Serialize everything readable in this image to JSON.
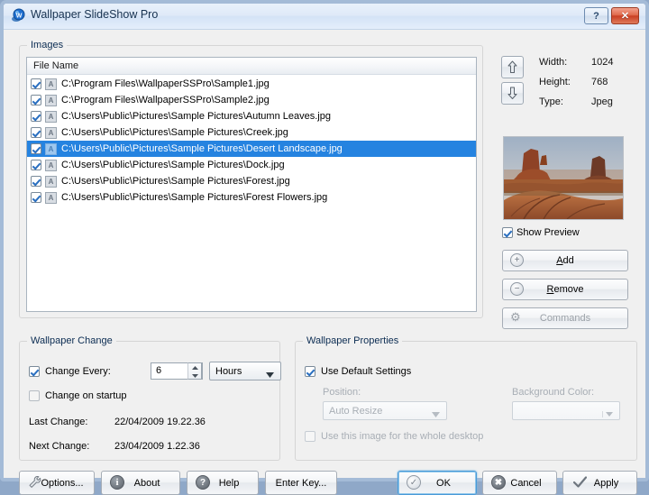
{
  "window": {
    "title": "Wallpaper SlideShow Pro",
    "icon": "app-logo-icon",
    "help_button": "?",
    "close_button": "✕"
  },
  "images_group": {
    "label": "Images",
    "column_header": "File Name",
    "rows": [
      {
        "checked": true,
        "tag": "A",
        "path": "C:\\Program Files\\WallpaperSSPro\\Sample1.jpg",
        "selected": false
      },
      {
        "checked": true,
        "tag": "A",
        "path": "C:\\Program Files\\WallpaperSSPro\\Sample2.jpg",
        "selected": false
      },
      {
        "checked": true,
        "tag": "A",
        "path": "C:\\Users\\Public\\Pictures\\Sample Pictures\\Autumn Leaves.jpg",
        "selected": false
      },
      {
        "checked": true,
        "tag": "A",
        "path": "C:\\Users\\Public\\Pictures\\Sample Pictures\\Creek.jpg",
        "selected": false
      },
      {
        "checked": true,
        "tag": "A",
        "path": "C:\\Users\\Public\\Pictures\\Sample Pictures\\Desert Landscape.jpg",
        "selected": true
      },
      {
        "checked": true,
        "tag": "A",
        "path": "C:\\Users\\Public\\Pictures\\Sample Pictures\\Dock.jpg",
        "selected": false
      },
      {
        "checked": true,
        "tag": "A",
        "path": "C:\\Users\\Public\\Pictures\\Sample Pictures\\Forest.jpg",
        "selected": false
      },
      {
        "checked": true,
        "tag": "A",
        "path": "C:\\Users\\Public\\Pictures\\Sample Pictures\\Forest Flowers.jpg",
        "selected": false
      }
    ]
  },
  "side_panel": {
    "move_up": "⬆",
    "move_down": "⬇",
    "width_label": "Width:",
    "width_value": "1024",
    "height_label": "Height:",
    "height_value": "768",
    "type_label": "Type:",
    "type_value": "Jpeg",
    "preview_alt": "desert-landscape-preview",
    "show_preview_label": "Show Preview",
    "show_preview_checked": true,
    "add_label": "Add",
    "add_accel": "A",
    "remove_label": "Remove",
    "remove_accel": "R",
    "commands_label": "Commands",
    "commands_enabled": false
  },
  "wallpaper_change": {
    "label": "Wallpaper Change",
    "change_every_label": "Change Every:",
    "change_every_checked": true,
    "interval_value": "6",
    "unit_value": "Hours",
    "change_on_startup_label": "Change on startup",
    "change_on_startup_checked": false,
    "last_change_label": "Last Change:",
    "last_change_value": "22/04/2009 19.22.36",
    "next_change_label": "Next Change:",
    "next_change_value": "23/04/2009 1.22.36"
  },
  "wallpaper_properties": {
    "label": "Wallpaper Properties",
    "use_default_label": "Use Default Settings",
    "use_default_checked": true,
    "position_label": "Position:",
    "position_value": "Auto Resize",
    "background_color_label": "Background Color:",
    "background_color_value": "",
    "whole_desktop_label": "Use this image for the whole desktop",
    "whole_desktop_checked": false
  },
  "footer": {
    "options_label": "Options...",
    "about_label": "About",
    "help_label": "Help",
    "enter_key_label": "Enter Key...",
    "ok_label": "OK",
    "cancel_label": "Cancel",
    "apply_label": "Apply"
  },
  "colors": {
    "selection_blue": "#2583e0",
    "dialog_bg": "#f0f0f0",
    "close_red": "#c93f23",
    "focus_ring": "#4a9ad8"
  }
}
